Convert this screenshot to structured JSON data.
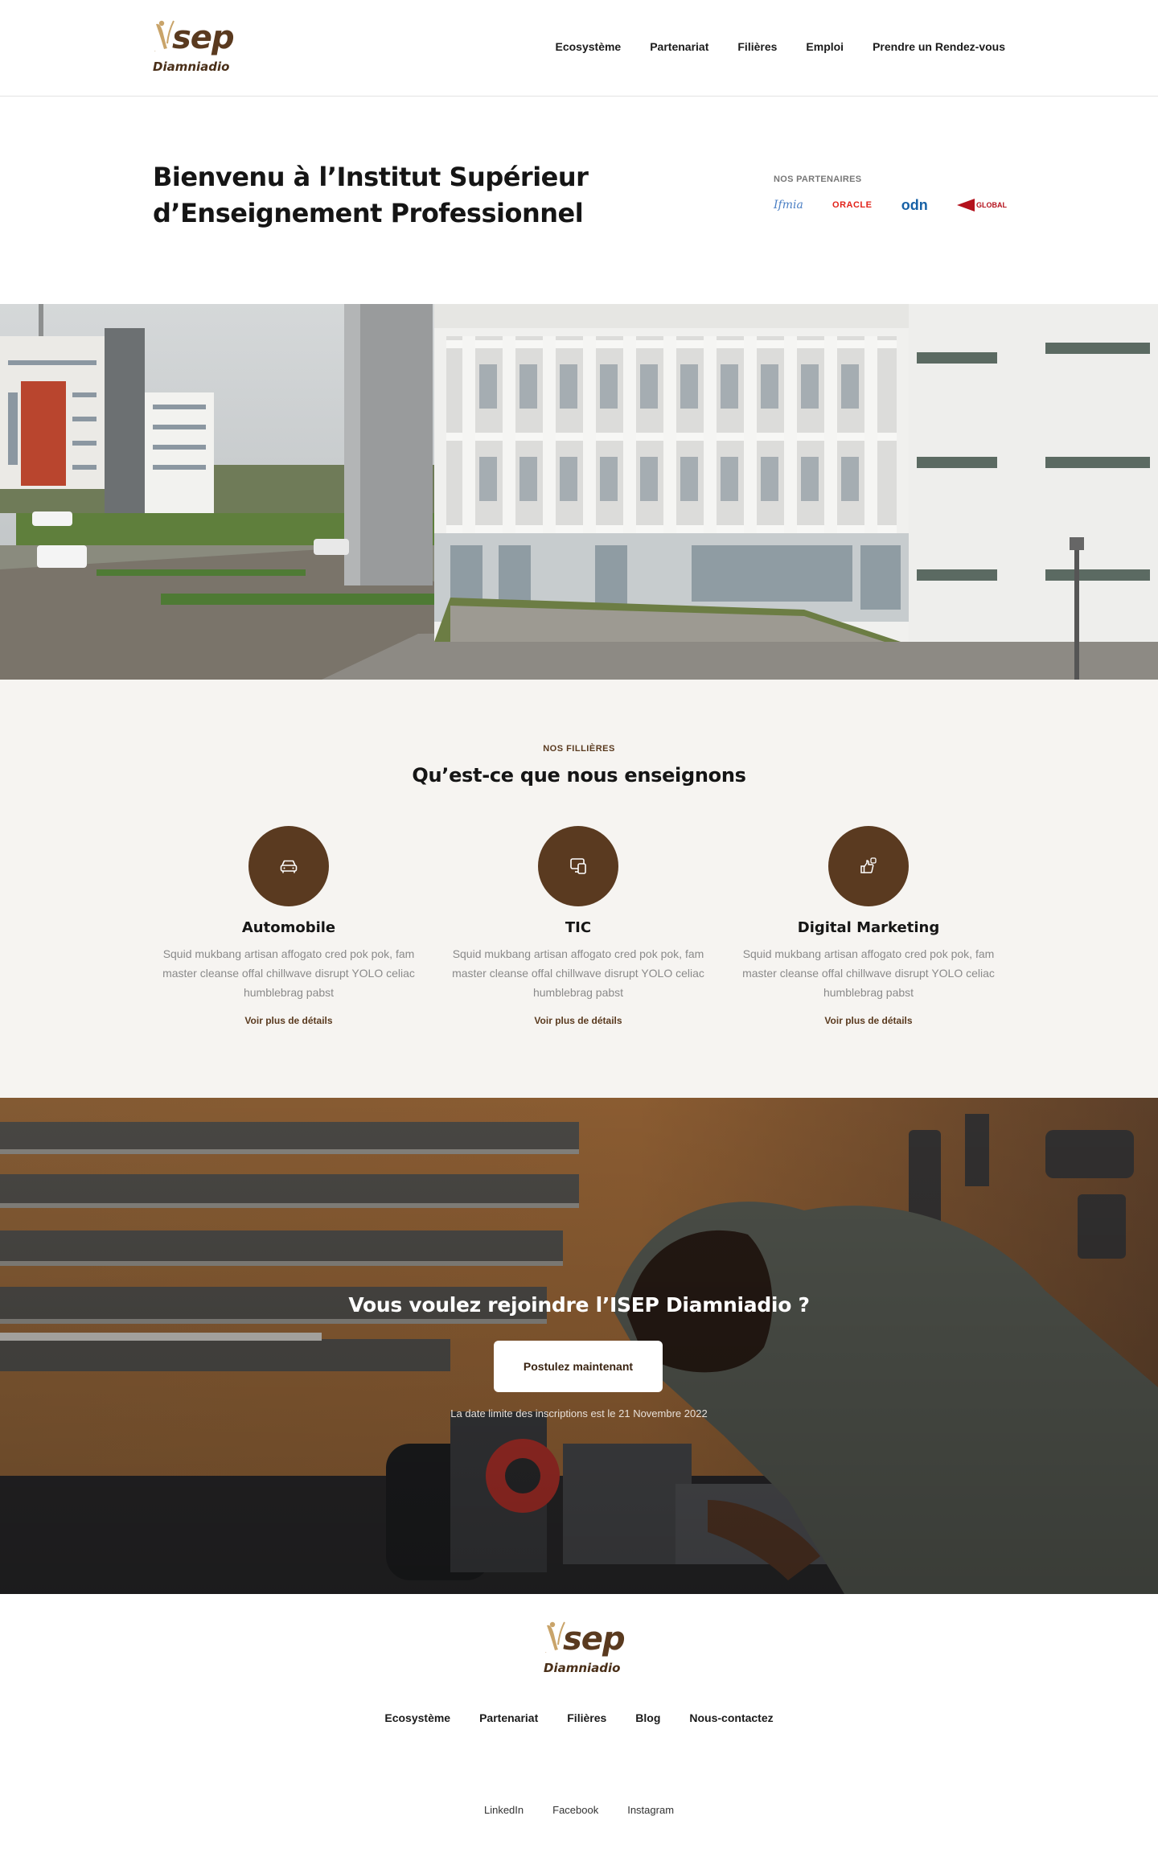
{
  "header": {
    "logo_word": "sep",
    "logo_town": "Diamniadio",
    "nav": [
      "Ecosystème",
      "Partenariat",
      "Filières",
      "Emploi",
      "Prendre un Rendez-vous"
    ]
  },
  "hero": {
    "title_line1": "Bienvenu à l’Institut Supérieur",
    "title_line2": "d’Enseignement Professionnel",
    "partners_label": "NOS PARTENAIRES",
    "partners": [
      "Ifmia",
      "ORACLE",
      "odn",
      "GLOBAL"
    ]
  },
  "filieres": {
    "eyebrow": "NOS FILLIÈRES",
    "title": "Qu’est-ce que nous enseignons",
    "cards": [
      {
        "icon": "car-icon",
        "title": "Automobile",
        "text": "Squid mukbang artisan affogato cred pok pok, fam master cleanse offal chillwave disrupt YOLO celiac humblebrag pabst",
        "link": "Voir plus de détails"
      },
      {
        "icon": "devices-icon",
        "title": "TIC",
        "text": "Squid mukbang artisan affogato cred pok pok, fam master cleanse offal chillwave disrupt YOLO celiac humblebrag pabst",
        "link": "Voir plus de détails"
      },
      {
        "icon": "thumbs-up-icon",
        "title": "Digital Marketing",
        "text": "Squid mukbang artisan affogato cred pok pok, fam master cleanse offal chillwave disrupt YOLO celiac humblebrag pabst",
        "link": "Voir plus de détails"
      }
    ]
  },
  "cta": {
    "title": "Vous voulez rejoindre l’ISEP Diamniadio ?",
    "button": "Postulez maintenant",
    "deadline": "La date limite des inscriptions est le 21 Novembre 2022"
  },
  "footer": {
    "logo_word": "sep",
    "logo_town": "Diamniadio",
    "nav": [
      "Ecosystème",
      "Partenariat",
      "Filières",
      "Blog",
      "Nous-contactez"
    ],
    "social": [
      "LinkedIn",
      "Facebook",
      "Instagram"
    ]
  },
  "colors": {
    "brand_brown": "#5a3a20",
    "section_bg": "#f6f4f1"
  }
}
